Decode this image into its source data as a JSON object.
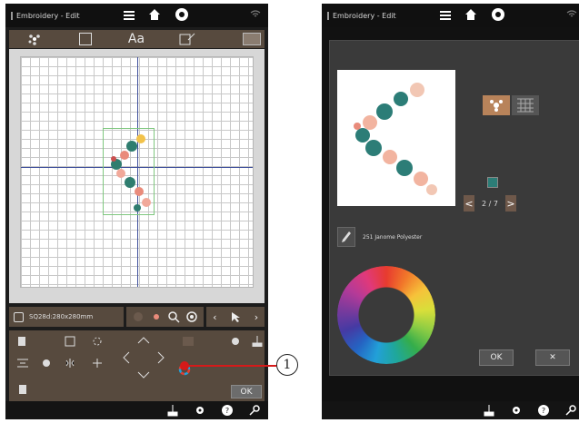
{
  "left_screen": {
    "title": "Embroidery - Edit",
    "hoop_size": "SQ28d:280x280mm",
    "ok_label": "OK",
    "icons": [
      "hamburger-icon",
      "home-icon",
      "janome-logo-icon",
      "wifi-icon"
    ],
    "tabs": [
      {
        "name": "tab-embroidery-designs",
        "icon": "flower-icon"
      },
      {
        "name": "tab-pattern",
        "icon": "pattern-box-icon"
      },
      {
        "name": "tab-text",
        "label": "Aa"
      },
      {
        "name": "tab-edit",
        "icon": "edit-design-icon"
      },
      {
        "name": "tab-dropdown",
        "icon": "chevron-down-icon"
      }
    ]
  },
  "right_screen": {
    "title": "Embroidery - Edit",
    "thread_name": "251 Janome Polyester",
    "page_indicator": "2 / 7",
    "prev_label": "<",
    "next_label": ">",
    "ok_label": "OK",
    "cancel_label": "✕",
    "swatch_color": "#2c7d77"
  },
  "callout": {
    "number": "1"
  },
  "colors": {
    "panel_brown": "#574a3e",
    "accent_red": "#d51a1a",
    "toggle_active": "#b8835a"
  }
}
